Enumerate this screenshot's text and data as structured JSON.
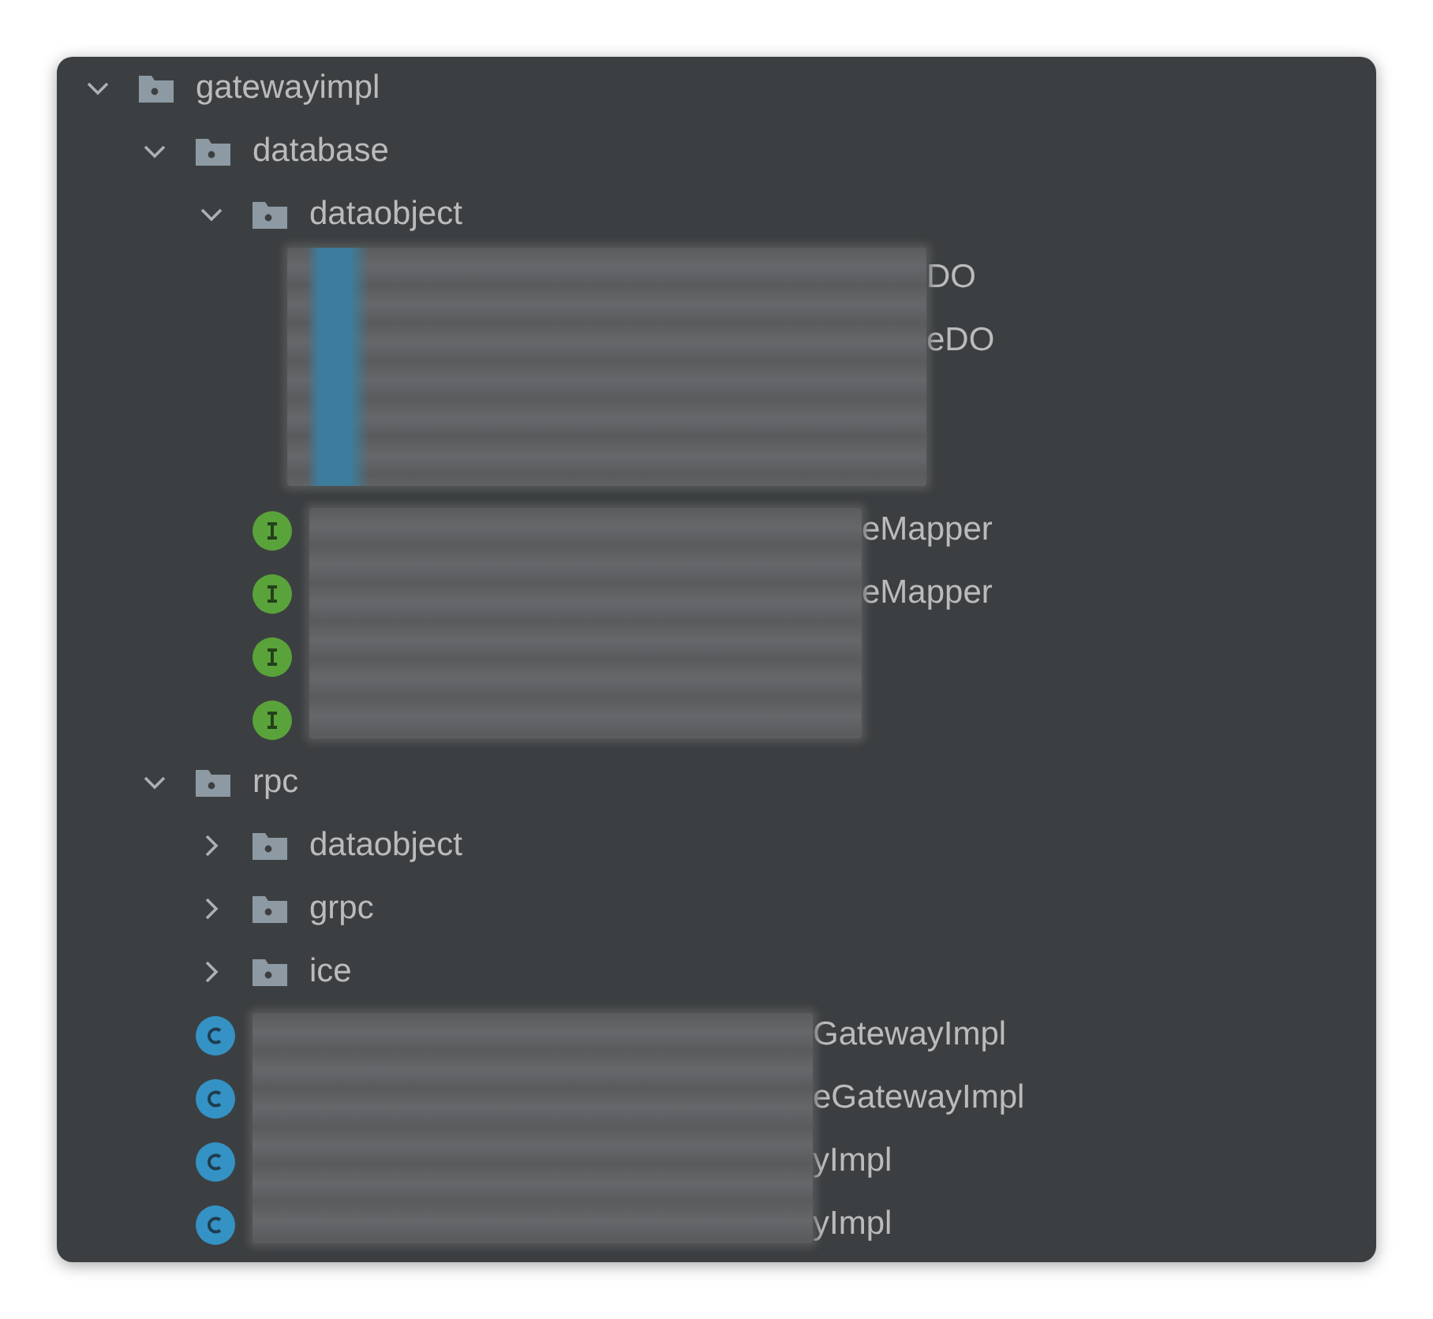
{
  "tree": [
    {
      "kind": "folder",
      "label": "gatewayimpl",
      "expanded": true,
      "children": [
        {
          "kind": "folder",
          "label": "database",
          "expanded": true,
          "children": [
            {
              "kind": "folder",
              "label": "dataobject",
              "expanded": true,
              "children": [
                {
                  "label": "DO",
                  "redacted": true
                },
                {
                  "label": "eDO",
                  "redacted": true
                },
                {
                  "redacted": true
                },
                {
                  "redacted": true
                }
              ]
            },
            {
              "kind": "interface",
              "label": "eMapper",
              "redacted": true
            },
            {
              "kind": "interface",
              "label": "eMapper",
              "redacted": true
            },
            {
              "kind": "interface",
              "redacted": true
            },
            {
              "kind": "interface",
              "redacted": true
            }
          ]
        },
        {
          "kind": "folder",
          "label": "rpc",
          "expanded": true,
          "children": [
            {
              "kind": "folder",
              "label": "dataobject",
              "expanded": false
            },
            {
              "kind": "folder",
              "label": "grpc",
              "expanded": false
            },
            {
              "kind": "folder",
              "label": "ice",
              "expanded": false
            }
          ]
        },
        {
          "kind": "class",
          "label": "GatewayImpl",
          "redacted": true
        },
        {
          "kind": "class",
          "label": "eGatewayImpl",
          "redacted": true
        },
        {
          "kind": "class",
          "label": "yImpl",
          "redacted": true
        },
        {
          "kind": "class",
          "label": "yImpl",
          "redacted": true
        }
      ]
    }
  ]
}
